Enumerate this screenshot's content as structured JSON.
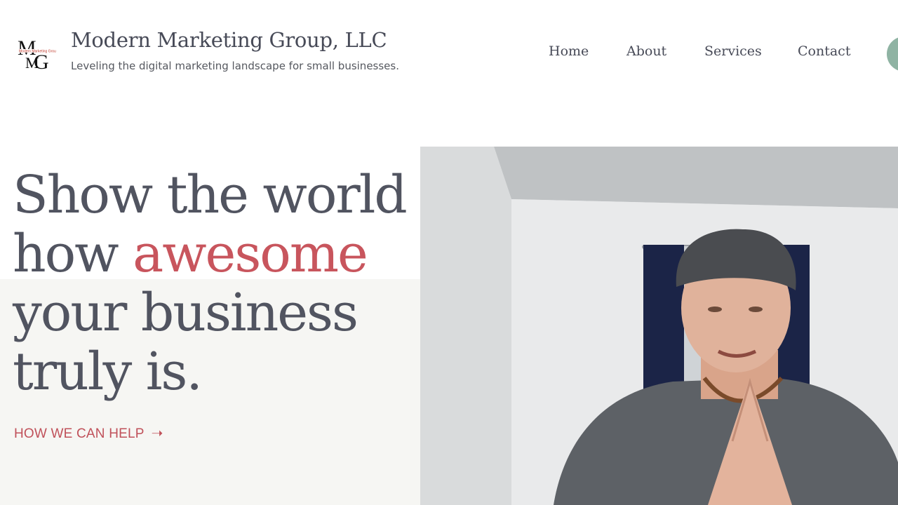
{
  "brand": {
    "logo_text": "MMG",
    "logo_caption": "Modern Marketing Group",
    "title": "Modern Marketing Group, LLC",
    "tagline": "Leveling the digital marketing landscape for small businesses."
  },
  "nav": {
    "items": [
      {
        "label": "Home"
      },
      {
        "label": "About"
      },
      {
        "label": "Services"
      },
      {
        "label": "Contact"
      }
    ]
  },
  "hero": {
    "line1": "Show the world",
    "line2_prefix": "how ",
    "line2_accent": "awesome",
    "line3": "your business",
    "line4": "truly is.",
    "link_label": "HOW WE CAN HELP",
    "link_icon": "arrow-right-icon"
  },
  "video": {
    "thumbnail": "man-speaking-video"
  },
  "colors": {
    "heading": "#515460",
    "accent": "#c8555d",
    "cta_circle": "#8fb3a3",
    "hero_band": "#f6f6f3"
  }
}
